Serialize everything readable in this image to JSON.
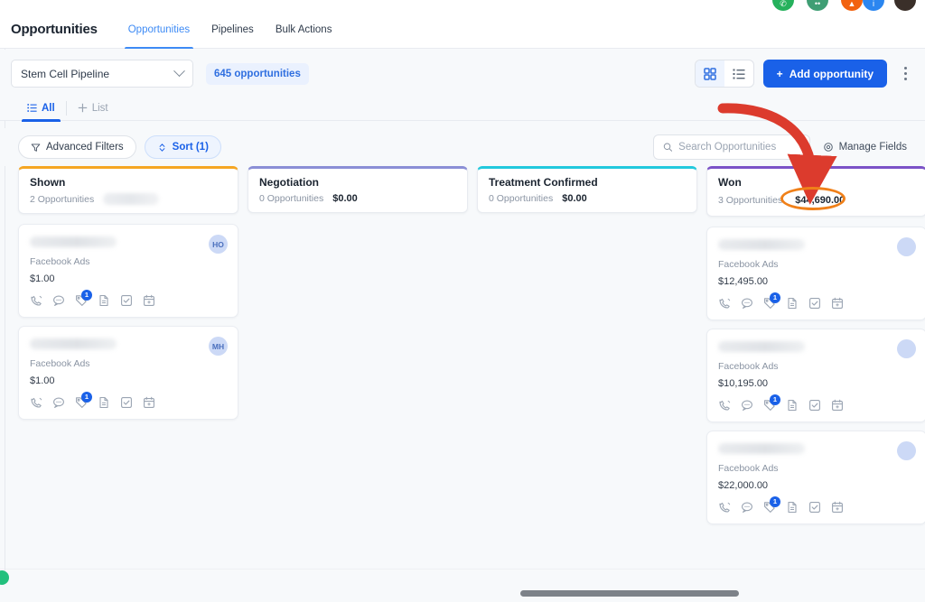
{
  "top_avatars": [
    {
      "name": "whatsapp-bubble",
      "color": "#25b15c",
      "glyph": "✆"
    },
    {
      "name": "chat-bubble",
      "color": "#3f9e74",
      "glyph": "••"
    },
    {
      "name": "notification-bubble",
      "color": "#f2620f",
      "glyph": "▲"
    },
    {
      "name": "info-bubble",
      "color": "#2b86f0",
      "glyph": "i"
    },
    {
      "name": "user-avatar",
      "color": "#3a2f29",
      "glyph": ""
    }
  ],
  "header": {
    "title": "Opportunities",
    "tabs": [
      {
        "label": "Opportunities",
        "active": true
      },
      {
        "label": "Pipelines",
        "active": false
      },
      {
        "label": "Bulk Actions",
        "active": false
      }
    ]
  },
  "toolbar": {
    "pipeline_value": "Stem Cell Pipeline",
    "opportunity_count": "645 opportunities",
    "grid_view_active": true,
    "list_view_active": false,
    "add_label": "Add opportunity",
    "add_plus": "+",
    "accent": "#1a61e8"
  },
  "subtabs": [
    {
      "label": "All",
      "active": true
    },
    {
      "label": "List",
      "active": false
    }
  ],
  "filters": {
    "advanced_label": "Advanced Filters",
    "sort_label": "Sort (1)",
    "manage_fields_label": "Manage Fields"
  },
  "search": {
    "value": "",
    "placeholder": "Search Opportunities"
  },
  "annotations": {
    "arrow_color": "#dc3b2d",
    "ellipse_color": "#f08019",
    "highlighted_value": "$44,690.00"
  },
  "board": {
    "columns": [
      {
        "title": "Shown",
        "accent": "#f5a623",
        "count": "2 Opportunities",
        "amount": "",
        "amount_blurred": true,
        "amount_highlighted": false,
        "cards": [
          {
            "name_redacted": true,
            "source": "Facebook Ads",
            "amount": "$1.00",
            "avatar": "HO",
            "badge": "1"
          },
          {
            "name_redacted": true,
            "source": "Facebook Ads",
            "amount": "$1.00",
            "avatar": "MH",
            "badge": "1"
          }
        ]
      },
      {
        "title": "Negotiation",
        "accent": "#8b8fd6",
        "count": "0 Opportunities",
        "amount": "$0.00",
        "amount_blurred": false,
        "amount_highlighted": false,
        "cards": []
      },
      {
        "title": "Treatment Confirmed",
        "accent": "#22c9dd",
        "count": "0 Opportunities",
        "amount": "$0.00",
        "amount_blurred": false,
        "amount_highlighted": false,
        "cards": []
      },
      {
        "title": "Won",
        "accent": "#7b52c7",
        "count": "3 Opportunities",
        "amount": "$44,690.00",
        "amount_blurred": false,
        "amount_highlighted": true,
        "cards": [
          {
            "name_redacted": true,
            "source": "Facebook Ads",
            "amount": "$12,495.00",
            "avatar": "",
            "badge": "1"
          },
          {
            "name_redacted": true,
            "source": "Facebook Ads",
            "amount": "$10,195.00",
            "avatar": "",
            "badge": "1"
          },
          {
            "name_redacted": true,
            "source": "Facebook Ads",
            "amount": "$22,000.00",
            "avatar": "",
            "badge": "1"
          }
        ]
      }
    ]
  },
  "card_icons": [
    "phone-icon",
    "chat-icon",
    "tag-icon",
    "document-icon",
    "task-icon",
    "calendar-icon"
  ]
}
